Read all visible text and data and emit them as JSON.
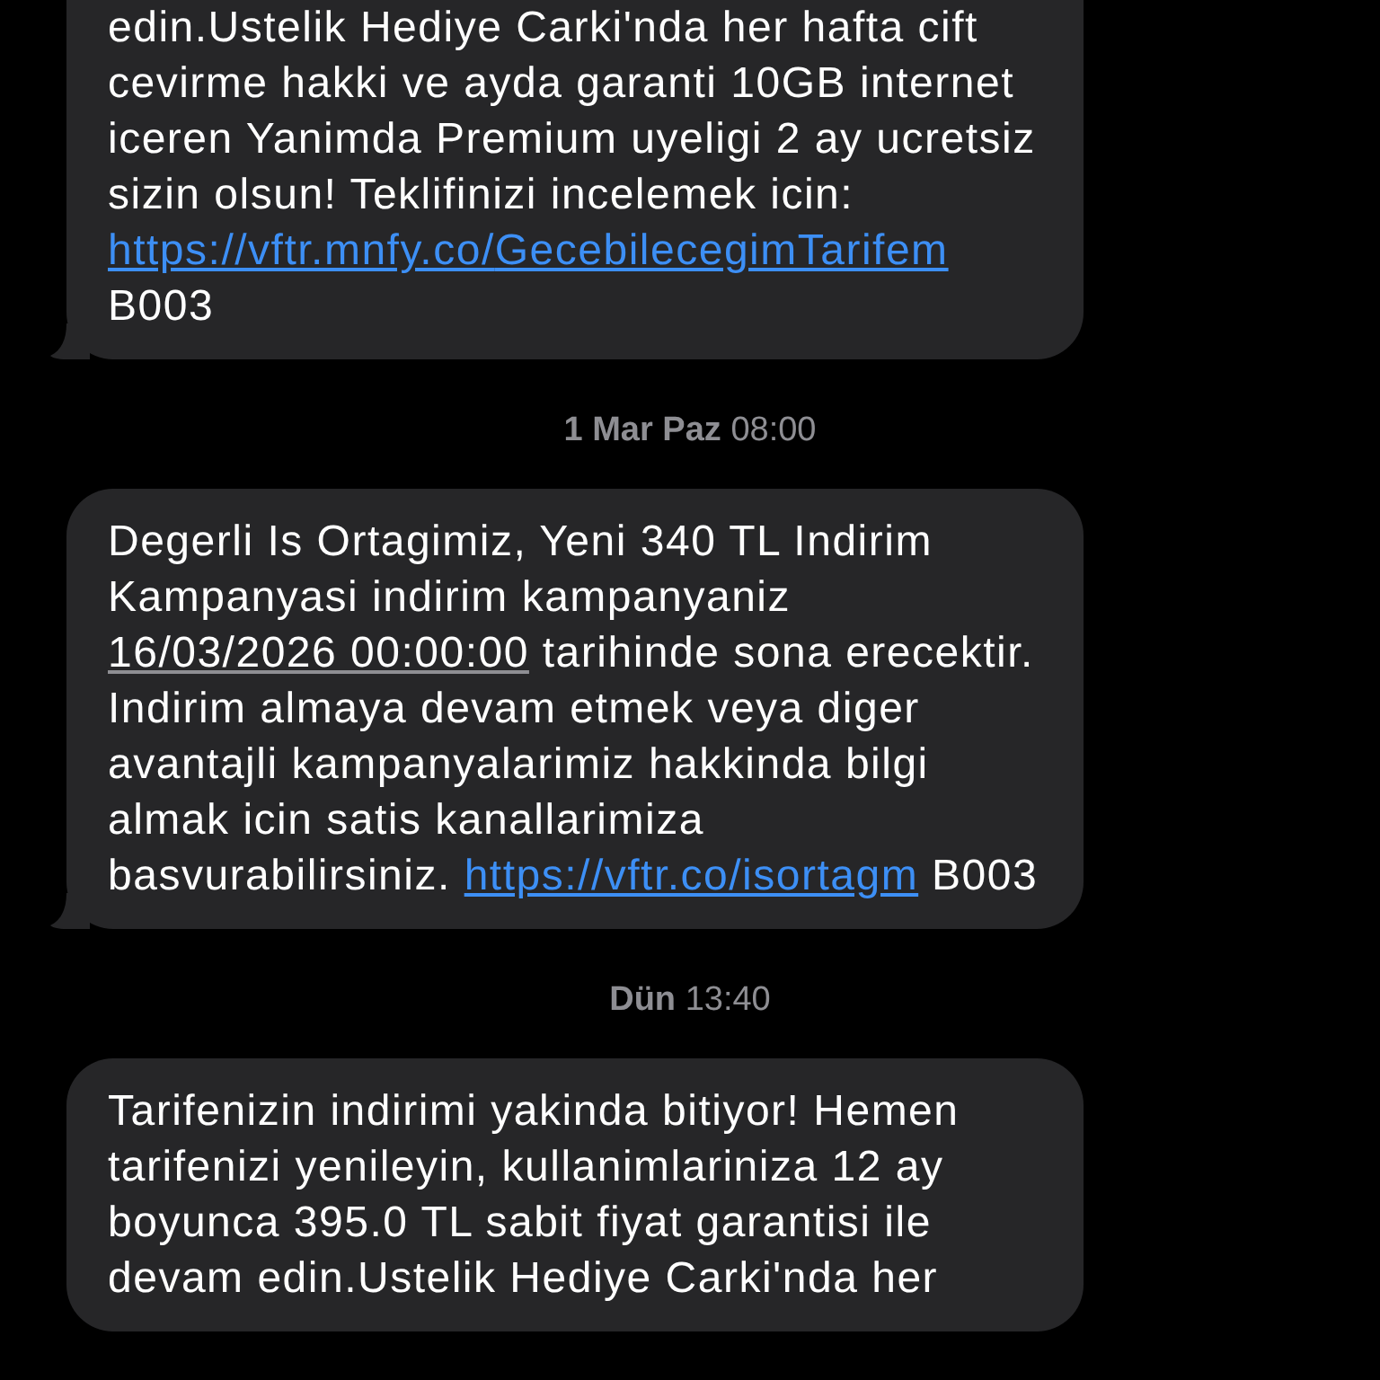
{
  "messages": [
    {
      "tail": true,
      "segments": [
        {
          "kind": "text",
          "text": "edin.Ustelik Hediye Carki'nda her hafta cift cevirme hakki ve ayda garanti 10GB internet iceren Yanimda Premium uyeligi 2 ay ucretsiz sizin olsun! Teklifinizi incelemek icin: "
        },
        {
          "kind": "link",
          "text": "https://vftr.mnfy.co/"
        },
        {
          "kind": "link",
          "text": "GecebilecegimTarifem"
        },
        {
          "kind": "text",
          "text": " B003"
        }
      ]
    },
    {
      "stamp": {
        "day": "1 Mar Paz",
        "time": "08:00"
      },
      "tail": true,
      "segments": [
        {
          "kind": "text",
          "text": "Degerli Is Ortagimiz, Yeni 340 TL Indirim Kampanyasi indirim kampanyaniz "
        },
        {
          "kind": "date",
          "text": "16/03/2026 00:00:00"
        },
        {
          "kind": "text",
          "text": " tarihinde sona erecektir. Indirim almaya devam etmek veya diger avantajli kampanyalarimiz hakkinda bilgi almak icin satis kanallarimiza basvurabilirsiniz. "
        },
        {
          "kind": "link",
          "text": "https://vftr.co/isortagm"
        },
        {
          "kind": "text",
          "text": " B003"
        }
      ]
    },
    {
      "stamp": {
        "day": "Dün",
        "time": "13:40"
      },
      "tail": false,
      "segments": [
        {
          "kind": "text",
          "text": "Tarifenizin indirimi yakinda bitiyor! Hemen tarifenizi yenileyin, kullanimlariniza 12 ay boyunca 395.0 TL sabit fiyat garantisi ile devam edin.Ustelik Hediye Carki'nda her"
        }
      ]
    }
  ]
}
